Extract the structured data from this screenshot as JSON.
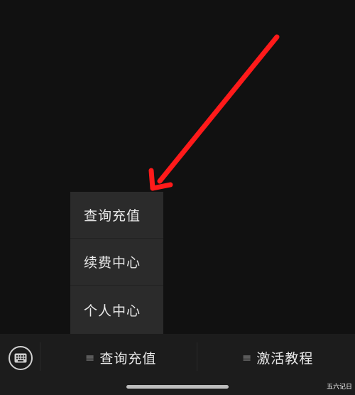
{
  "colors": {
    "background": "#111111",
    "arrow": "#ff1a1a",
    "popup_bg": "#2b2b2b",
    "bar_bg": "#1c1c1c",
    "text": "#e8e8e8"
  },
  "popup_menu": {
    "items": [
      {
        "label": "查询充值"
      },
      {
        "label": "续费中心"
      },
      {
        "label": "个人中心"
      }
    ]
  },
  "bottom_bar": {
    "keyboard_icon": "keyboard-icon",
    "tabs": [
      {
        "label": "查询充值",
        "icon": "menu-lines-icon"
      },
      {
        "label": "激活教程",
        "icon": "menu-lines-icon"
      }
    ]
  },
  "watermark": {
    "text": "五六记日"
  }
}
